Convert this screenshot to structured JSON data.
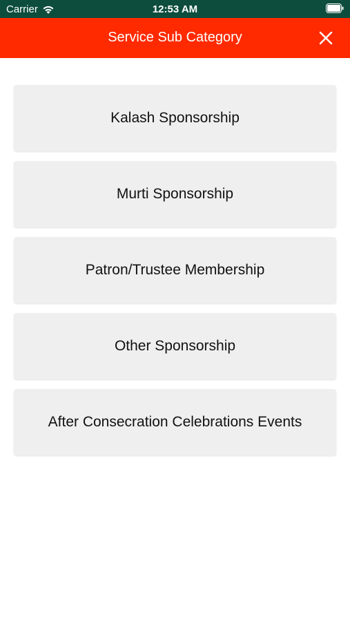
{
  "status_bar": {
    "carrier": "Carrier",
    "time": "12:53 AM",
    "wifi_icon": "wifi-icon",
    "battery_icon": "battery-icon"
  },
  "header": {
    "title": "Service Sub Category",
    "close_icon": "close-icon",
    "background_color": "#ff2a00"
  },
  "items": [
    {
      "label": "Kalash Sponsorship"
    },
    {
      "label": "Murti Sponsorship"
    },
    {
      "label": "Patron/Trustee Membership"
    },
    {
      "label": "Other Sponsorship"
    },
    {
      "label": "After Consecration Celebrations Events"
    }
  ]
}
